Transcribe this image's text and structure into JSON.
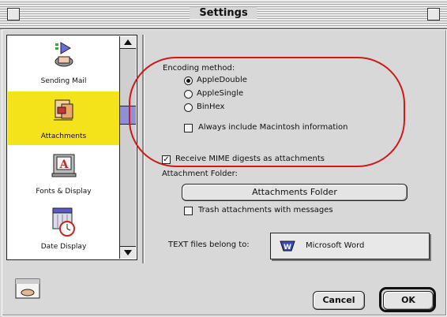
{
  "window": {
    "title": "Settings"
  },
  "sidebar": {
    "items": [
      {
        "label": "Sending Mail",
        "icon": "mail-send-icon"
      },
      {
        "label": "Attachments",
        "icon": "attachment-icon",
        "selected": true
      },
      {
        "label": "Fonts & Display",
        "icon": "font-icon"
      },
      {
        "label": "Date Display",
        "icon": "calendar-clock-icon"
      }
    ]
  },
  "encoding": {
    "heading": "Encoding method:",
    "options": [
      "AppleDouble",
      "AppleSingle",
      "BinHex"
    ],
    "selected": "AppleDouble",
    "always_include_label": "Always include Macintosh information",
    "always_include_checked": false
  },
  "mime": {
    "label": "Receive MIME digests as attachments",
    "checked": true
  },
  "folder": {
    "heading": "Attachment Folder:",
    "button_label": "Attachments Folder",
    "trash_label": "Trash attachments with messages",
    "trash_checked": false
  },
  "text_files": {
    "label": "TEXT files belong to:",
    "app": "Microsoft Word"
  },
  "footer": {
    "cancel_label": "Cancel",
    "ok_label": "OK"
  },
  "colors": {
    "selection": "#f4e21b",
    "annotation": "#d01818",
    "scroll_thumb": "#8f8fd8"
  }
}
